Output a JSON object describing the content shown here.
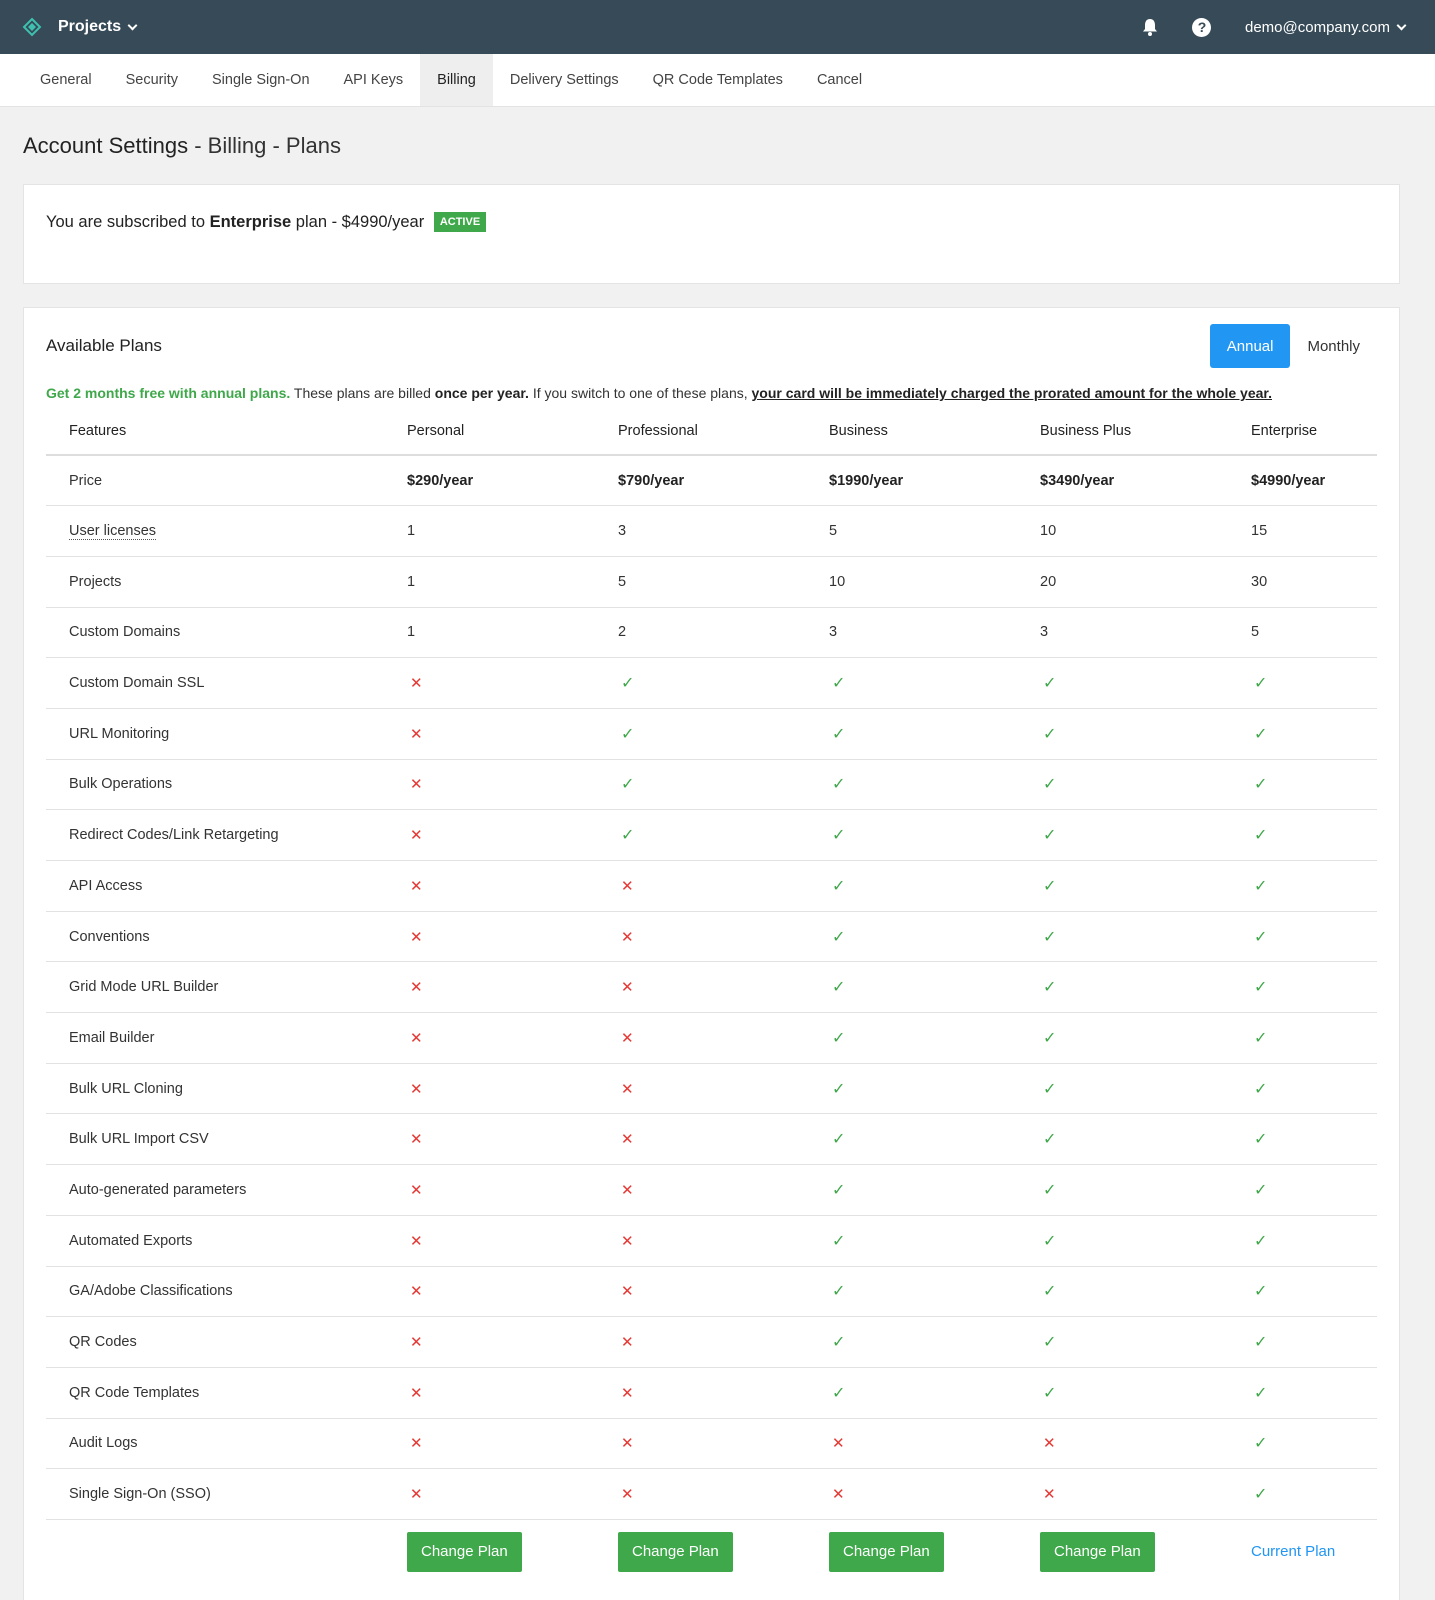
{
  "topbar": {
    "brand": "Projects",
    "user": "demo@company.com"
  },
  "tabs": [
    "General",
    "Security",
    "Single Sign-On",
    "API Keys",
    "Billing",
    "Delivery Settings",
    "QR Code Templates",
    "Cancel"
  ],
  "active_tab": "Billing",
  "page_title": {
    "main": "Account Settings",
    "rest": " - Billing - Plans"
  },
  "subscription": {
    "prefix": "You are subscribed to ",
    "plan": "Enterprise",
    "suffix": " plan - $4990/year",
    "badge": "ACTIVE"
  },
  "plans": {
    "title": "Available Plans",
    "toggle_annual": "Annual",
    "toggle_monthly": "Monthly",
    "note_green": "Get 2 months free with annual plans.",
    "note_1": " These plans are billed ",
    "note_bold": "once per year.",
    "note_2": " If you switch to one of these plans, ",
    "note_underline": "your card will be immediately charged the prorated amount for the whole year.",
    "headers": [
      "Features",
      "Personal",
      "Professional",
      "Business",
      "Business Plus",
      "Enterprise"
    ],
    "rows": [
      {
        "label": "Price",
        "values": [
          "$290/year",
          "$790/year",
          "$1990/year",
          "$3490/year",
          "$4990/year"
        ]
      },
      {
        "label": "User licenses",
        "values": [
          "1",
          "3",
          "5",
          "10",
          "15"
        ]
      },
      {
        "label": "Projects",
        "values": [
          "1",
          "5",
          "10",
          "20",
          "30"
        ]
      },
      {
        "label": "Custom Domains",
        "values": [
          "1",
          "2",
          "3",
          "3",
          "5"
        ]
      },
      {
        "label": "Custom Domain SSL",
        "values": [
          false,
          true,
          true,
          true,
          true
        ]
      },
      {
        "label": "URL Monitoring",
        "values": [
          false,
          true,
          true,
          true,
          true
        ]
      },
      {
        "label": "Bulk Operations",
        "values": [
          false,
          true,
          true,
          true,
          true
        ]
      },
      {
        "label": "Redirect Codes/Link Retargeting",
        "values": [
          false,
          true,
          true,
          true,
          true
        ]
      },
      {
        "label": "API Access",
        "values": [
          false,
          false,
          true,
          true,
          true
        ]
      },
      {
        "label": "Conventions",
        "values": [
          false,
          false,
          true,
          true,
          true
        ]
      },
      {
        "label": "Grid Mode URL Builder",
        "values": [
          false,
          false,
          true,
          true,
          true
        ]
      },
      {
        "label": "Email Builder",
        "values": [
          false,
          false,
          true,
          true,
          true
        ]
      },
      {
        "label": "Bulk URL Cloning",
        "values": [
          false,
          false,
          true,
          true,
          true
        ]
      },
      {
        "label": "Bulk URL Import CSV",
        "values": [
          false,
          false,
          true,
          true,
          true
        ]
      },
      {
        "label": "Auto-generated parameters",
        "values": [
          false,
          false,
          true,
          true,
          true
        ]
      },
      {
        "label": "Automated Exports",
        "values": [
          false,
          false,
          true,
          true,
          true
        ]
      },
      {
        "label": "GA/Adobe Classifications",
        "values": [
          false,
          false,
          true,
          true,
          true
        ]
      },
      {
        "label": "QR Codes",
        "values": [
          false,
          false,
          true,
          true,
          true
        ]
      },
      {
        "label": "QR Code Templates",
        "values": [
          false,
          false,
          true,
          true,
          true
        ]
      },
      {
        "label": "Audit Logs",
        "values": [
          false,
          false,
          false,
          false,
          true
        ]
      },
      {
        "label": "Single Sign-On (SSO)",
        "values": [
          false,
          false,
          false,
          false,
          true
        ]
      }
    ],
    "change_label": "Change Plan",
    "current_label": "Current Plan"
  }
}
